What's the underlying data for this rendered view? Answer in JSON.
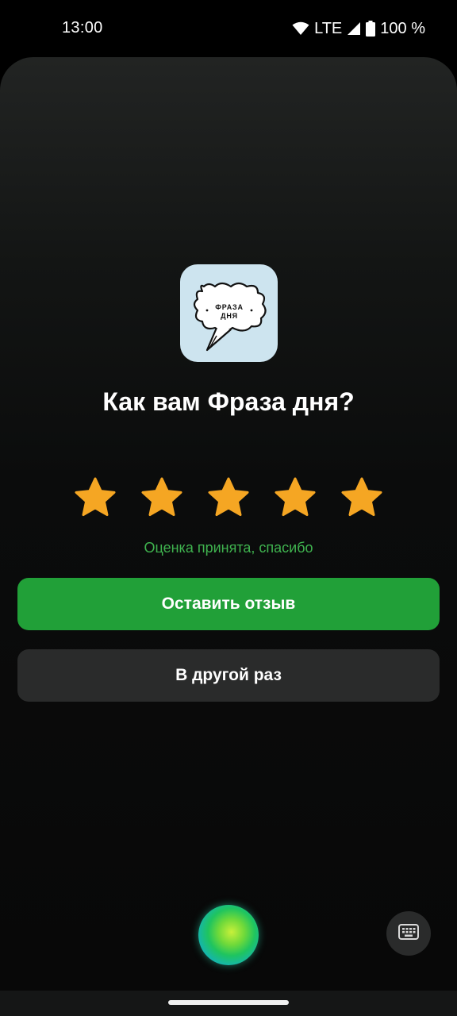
{
  "status_bar": {
    "time": "13:00",
    "network": "LTE",
    "battery": "100 %",
    "icons": [
      "wifi-icon",
      "signal-icon",
      "battery-icon"
    ]
  },
  "dialog": {
    "app_icon_text_line1": "ФРАЗА",
    "app_icon_text_line2": "ДНЯ",
    "title": "Как вам Фраза дня?",
    "rating": {
      "value": 5,
      "max": 5,
      "star_color": "#f5a623"
    },
    "status_message": "Оценка принята, спасибо",
    "primary_button": "Оставить отзыв",
    "secondary_button": "В другой раз"
  },
  "bottom": {
    "assistant_icon": "assistant-orb-icon",
    "keyboard_icon": "keyboard-icon"
  },
  "colors": {
    "accent_green": "#21a038",
    "status_green": "#3fb34f",
    "secondary_button_bg": "#2a2b2b"
  }
}
